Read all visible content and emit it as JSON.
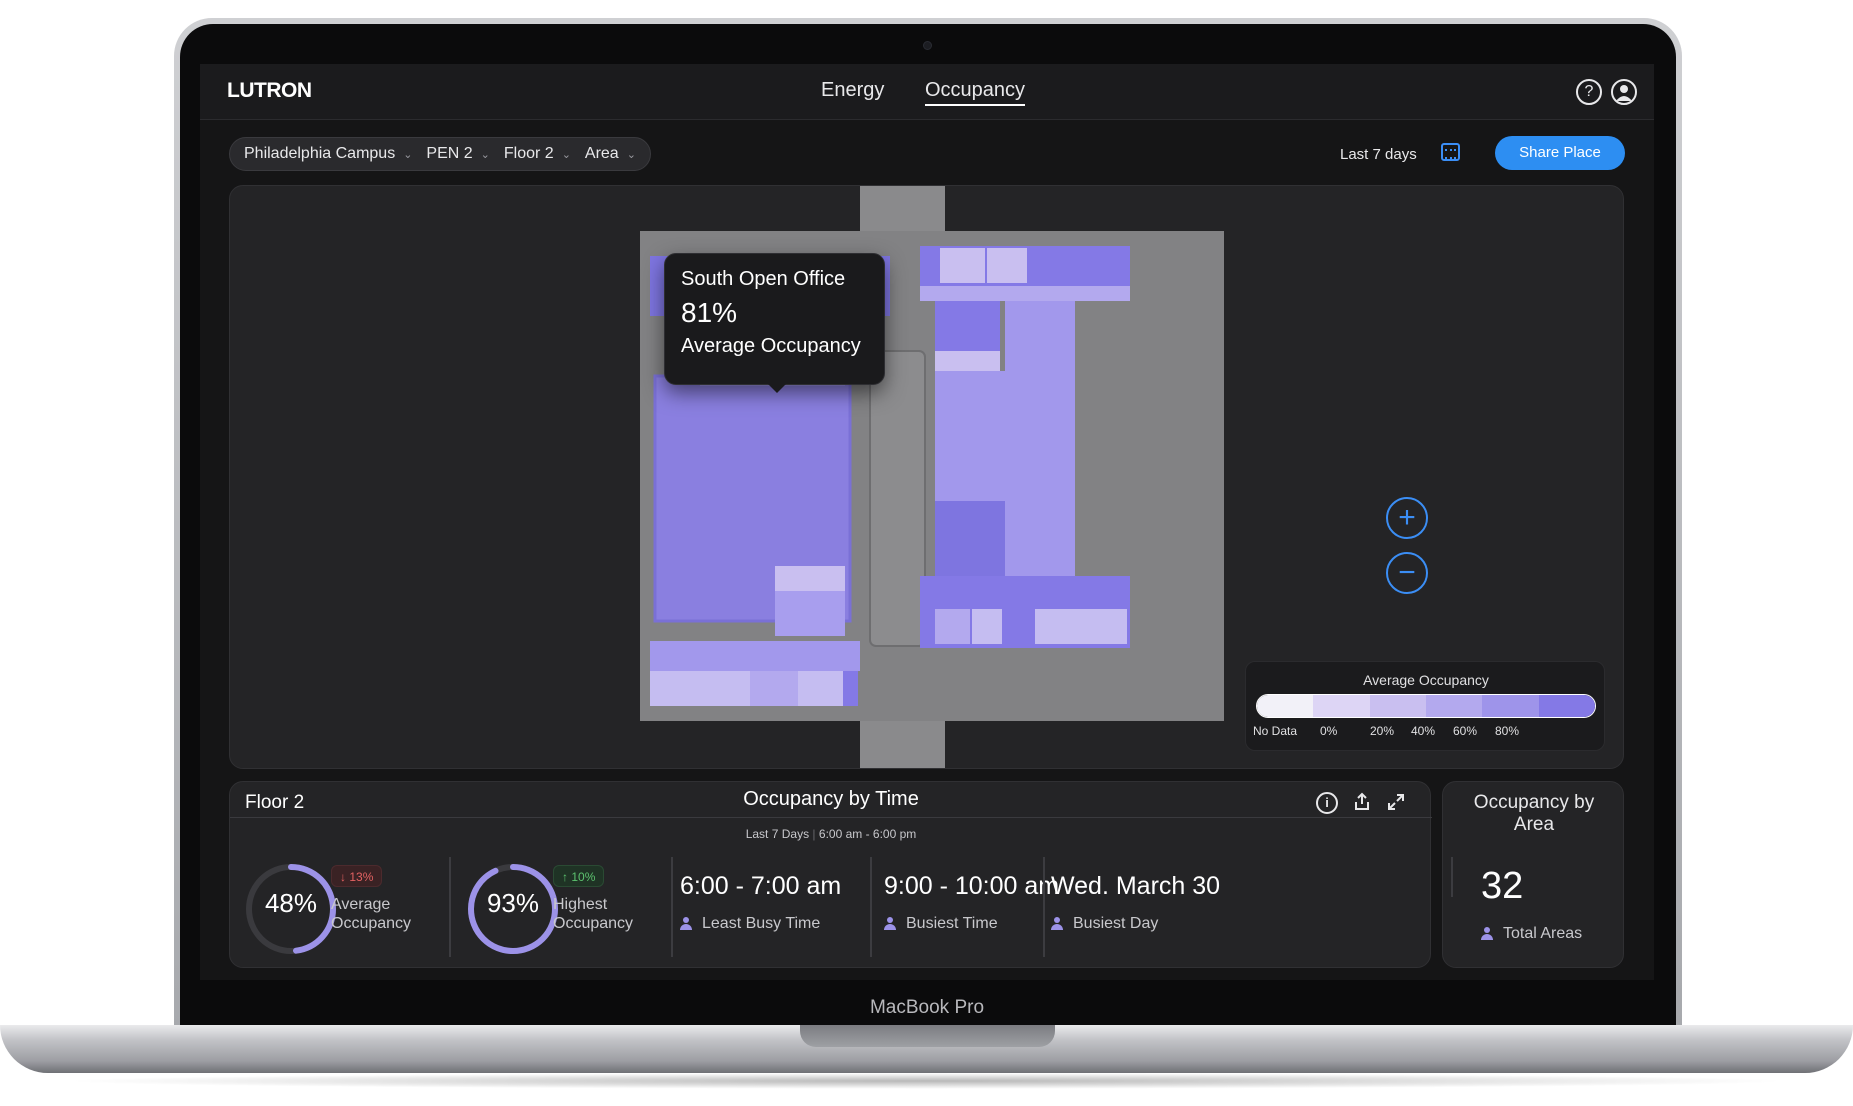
{
  "device": {
    "label": "MacBook Pro"
  },
  "header": {
    "logo": "LUTRON",
    "nav": [
      {
        "label": "Energy"
      },
      {
        "label": "Occupancy"
      }
    ],
    "active_tab": "Occupancy"
  },
  "toolbar": {
    "breadcrumbs": [
      {
        "label": "Philadelphia Campus"
      },
      {
        "label": "PEN 2"
      },
      {
        "label": "Floor 2"
      },
      {
        "label": "Area"
      }
    ],
    "date_range": "Last 7 days",
    "share_label": "Share Place",
    "accent_color": "#2d8ef2"
  },
  "map": {
    "tooltip": {
      "name": "South Open Office",
      "value": "81%",
      "label": "Average Occupancy"
    },
    "legend": {
      "title": "Average Occupancy",
      "labels": [
        "No Data",
        "0%",
        "20%",
        "40%",
        "60%",
        "80%"
      ],
      "colors": [
        "#f2f1f8",
        "#ddd5f5",
        "#c9bff0",
        "#b3a9ee",
        "#9e94ea",
        "#8479e6"
      ]
    },
    "zoom_in": "+",
    "zoom_out": "−"
  },
  "occupancy_by_time": {
    "floor": "Floor 2",
    "title": "Occupancy by Time",
    "subtitle_range": "Last 7 Days",
    "subtitle_hours": "6:00 am - 6:00 pm",
    "average": {
      "value": "48%",
      "fraction": 0.48,
      "change": "13%",
      "direction": "down",
      "label_line1": "Average",
      "label_line2": "Occupancy"
    },
    "highest": {
      "value": "93%",
      "fraction": 0.93,
      "change": "10%",
      "direction": "up",
      "label_line1": "Highest",
      "label_line2": "Occupancy"
    },
    "least_busy": {
      "value": "6:00 - 7:00 am",
      "label": "Least Busy Time"
    },
    "busiest_time": {
      "value": "9:00 - 10:00 am",
      "label": "Busiest Time"
    },
    "busiest_day": {
      "value": "Wed. March 30",
      "label": "Busiest Day"
    }
  },
  "occupancy_by_area": {
    "title_line1": "Occupancy by",
    "title_line2": "Area",
    "value": "32",
    "label": "Total Areas"
  }
}
